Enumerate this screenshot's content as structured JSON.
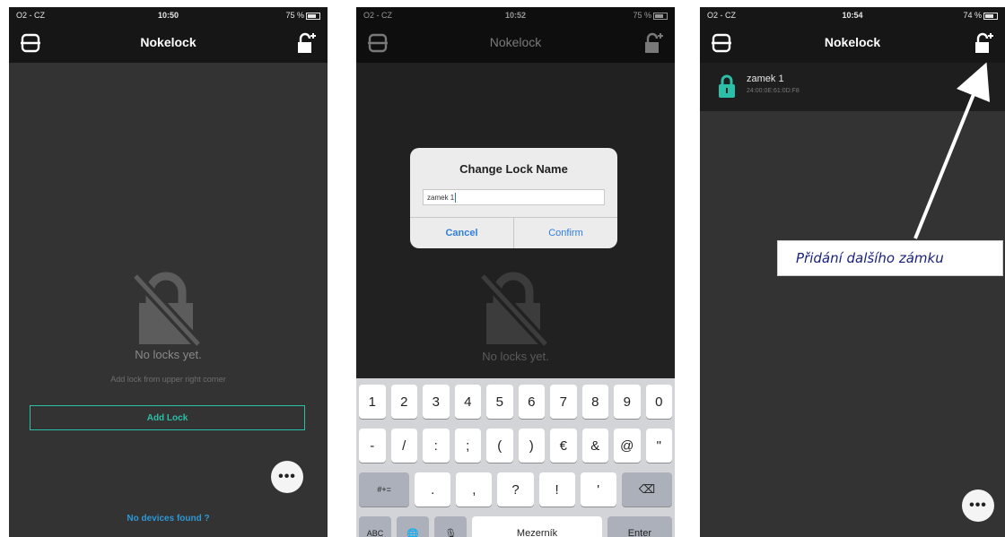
{
  "app_title": "Nokelock",
  "screens": [
    {
      "status": {
        "carrier": "O2 - CZ",
        "time": "10:50",
        "battery": "75 %"
      },
      "empty_title": "No locks yet.",
      "empty_subtitle": "Add lock from upper right corner",
      "add_lock_label": "Add Lock",
      "more_label": "•••",
      "no_devices_label": "No devices found ?"
    },
    {
      "status": {
        "carrier": "O2 - CZ",
        "time": "10:52",
        "battery": "75 %"
      },
      "empty_title": "No locks yet.",
      "dialog": {
        "title": "Change Lock Name",
        "input_value": "zamek 1",
        "cancel_label": "Cancel",
        "confirm_label": "Confirm"
      },
      "keyboard": {
        "row1": [
          "1",
          "2",
          "3",
          "4",
          "5",
          "6",
          "7",
          "8",
          "9",
          "0"
        ],
        "row2": [
          "-",
          "/",
          ":",
          ";",
          "(",
          ")",
          "€",
          "&",
          "@",
          "\""
        ],
        "row3": [
          "#+=",
          ".",
          ",",
          "?",
          "!",
          "'",
          "⌫"
        ],
        "row4": [
          "ABC",
          "🌐",
          "🎙",
          "Mezerník",
          "Enter"
        ]
      }
    },
    {
      "status": {
        "carrier": "O2 - CZ",
        "time": "10:54",
        "battery": "74 %"
      },
      "lock": {
        "name": "zamek 1",
        "mac": "24:00:0E:61:0D:F8"
      },
      "more_label": "•••"
    }
  ],
  "annotation": "Přidání dalšího zámku",
  "icons": {
    "left_nav": "scan-icon",
    "right_nav": "add-lock-icon",
    "empty": "no-lock-icon",
    "lock_item": "lock-icon"
  },
  "colors": {
    "accent": "#2bbfa8",
    "link": "#2e97d4",
    "dialog_button": "#2f7ee0",
    "lock_icon": "#2bbfa8",
    "annotation_text": "#1a237e"
  }
}
